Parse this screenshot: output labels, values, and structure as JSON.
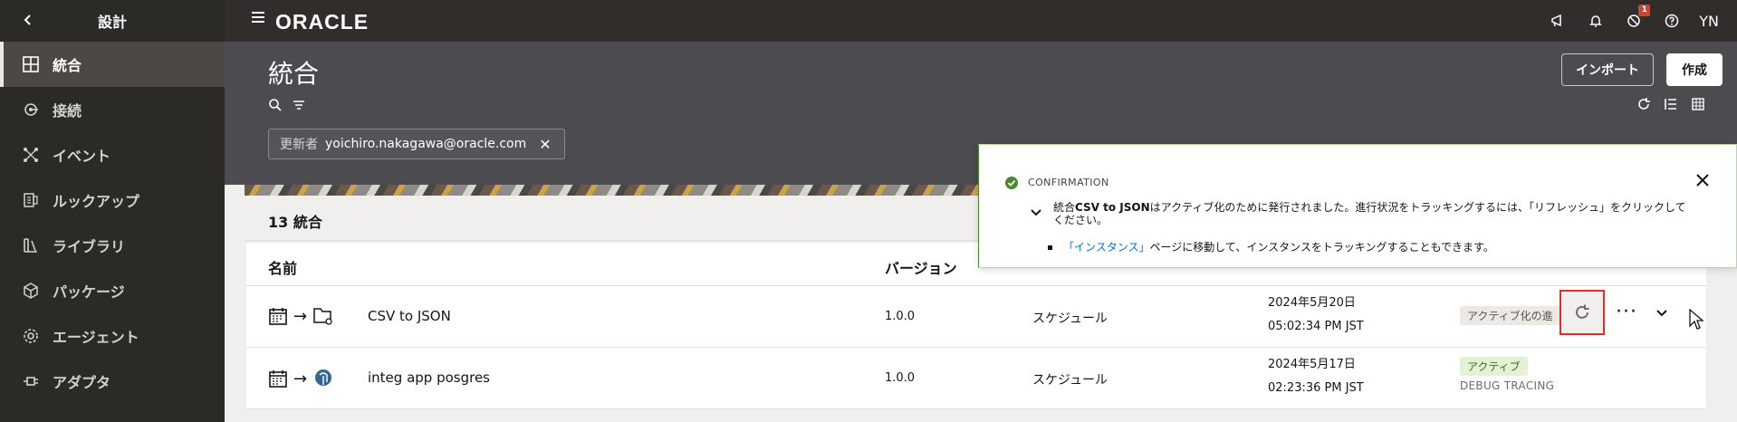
{
  "sidebar": {
    "title": "設計",
    "items": [
      {
        "label": "統合",
        "icon": "integration-icon",
        "active": true
      },
      {
        "label": "接続",
        "icon": "connection-icon"
      },
      {
        "label": "イベント",
        "icon": "event-icon"
      },
      {
        "label": "ルックアップ",
        "icon": "lookup-icon"
      },
      {
        "label": "ライブラリ",
        "icon": "library-icon"
      },
      {
        "label": "パッケージ",
        "icon": "package-icon"
      },
      {
        "label": "エージェント",
        "icon": "agent-icon"
      },
      {
        "label": "アダプタ",
        "icon": "adapter-icon"
      }
    ]
  },
  "topbar": {
    "logo": "ORACLE",
    "notification_badge": "1",
    "user_initials": "YN"
  },
  "page": {
    "title": "統合",
    "import_label": "インポート",
    "create_label": "作成",
    "filter": {
      "label": "更新者",
      "value": "yoichiro.nakagawa@oracle.com"
    },
    "count_label": "13 統合"
  },
  "table": {
    "headers": {
      "name": "名前",
      "version": "バージョン"
    },
    "rows": [
      {
        "name": "CSV to JSON",
        "version": "1.0.0",
        "pattern": "スケジュール",
        "date": "2024年5月20日",
        "time": "05:02:34 PM JST",
        "status": "アクティブ化の進"
      },
      {
        "name": "integ app posgres",
        "version": "1.0.0",
        "pattern": "スケジュール",
        "date": "2024年5月17日",
        "time": "02:23:36 PM JST",
        "status": "アクティブ",
        "tracing": "DEBUG TRACING"
      }
    ]
  },
  "toast": {
    "title": "CONFIRMATION",
    "msg_prefix": "統合",
    "msg_bold": "CSV to JSON",
    "msg_rest": "はアクティブ化のために発行されました。進行状況をトラッキングするには、「リフレッシュ」をクリックしてください。",
    "bullet_link": "「インスタンス」",
    "bullet_rest": "ページに移動して、インスタンスをトラッキングすることもできます。"
  },
  "colors": {
    "sidebar_bg": "#2b2a27",
    "header_bg": "#4c4b50",
    "topbar_bg": "#312d2a",
    "success": "#4b8a2b",
    "highlight_border": "#d9322b",
    "link": "#0572ce"
  }
}
